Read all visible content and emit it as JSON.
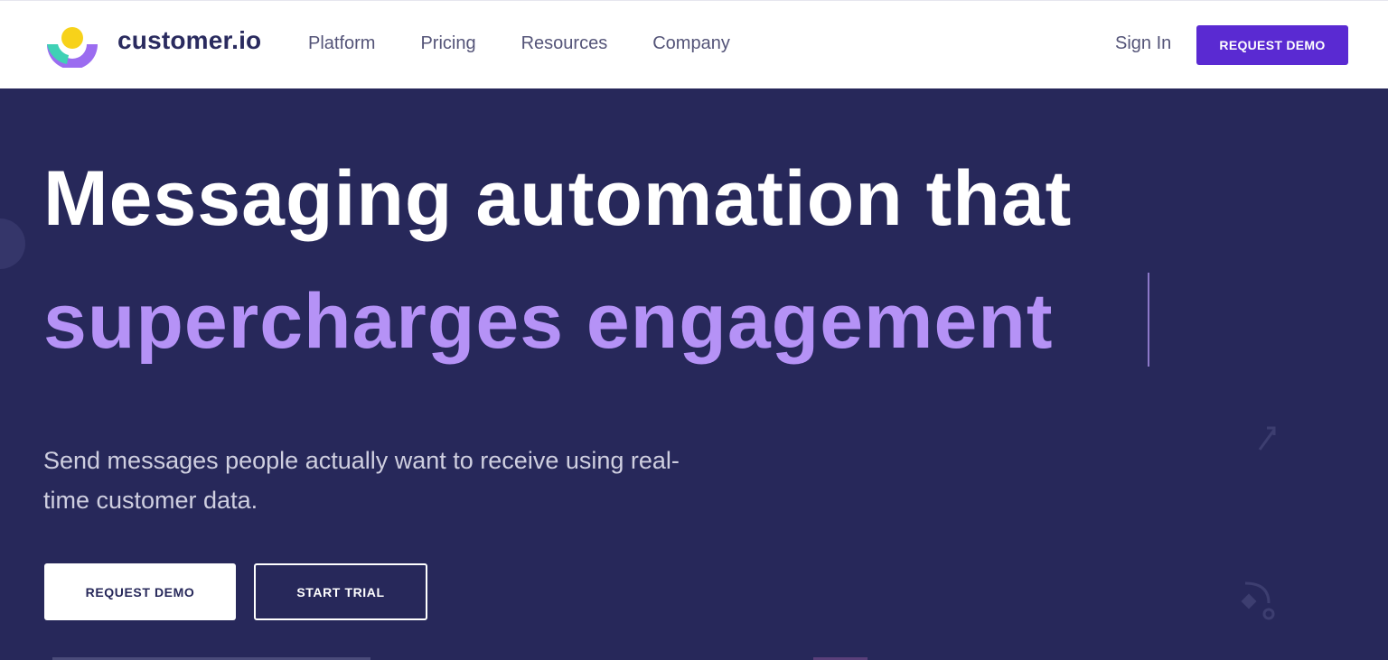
{
  "brand": {
    "name": "customer.io",
    "colors": {
      "purple": "#5a2ad2",
      "yellow": "#f7d21a",
      "teal": "#3fd1b5",
      "violet": "#9b6cf0",
      "navy": "#27285a"
    }
  },
  "nav": {
    "links": [
      {
        "label": "Platform"
      },
      {
        "label": "Pricing"
      },
      {
        "label": "Resources"
      },
      {
        "label": "Company"
      }
    ],
    "sign_in": "Sign In",
    "cta": "REQUEST DEMO"
  },
  "hero": {
    "headline_line1": "Messaging automation that",
    "headline_line2": "supercharges engagement",
    "subtext": "Send messages people actually want to receive using real-time customer data.",
    "primary_cta": "REQUEST DEMO",
    "secondary_cta": "START TRIAL",
    "colors": {
      "background": "#27285a",
      "highlight": "#b592f6"
    }
  }
}
